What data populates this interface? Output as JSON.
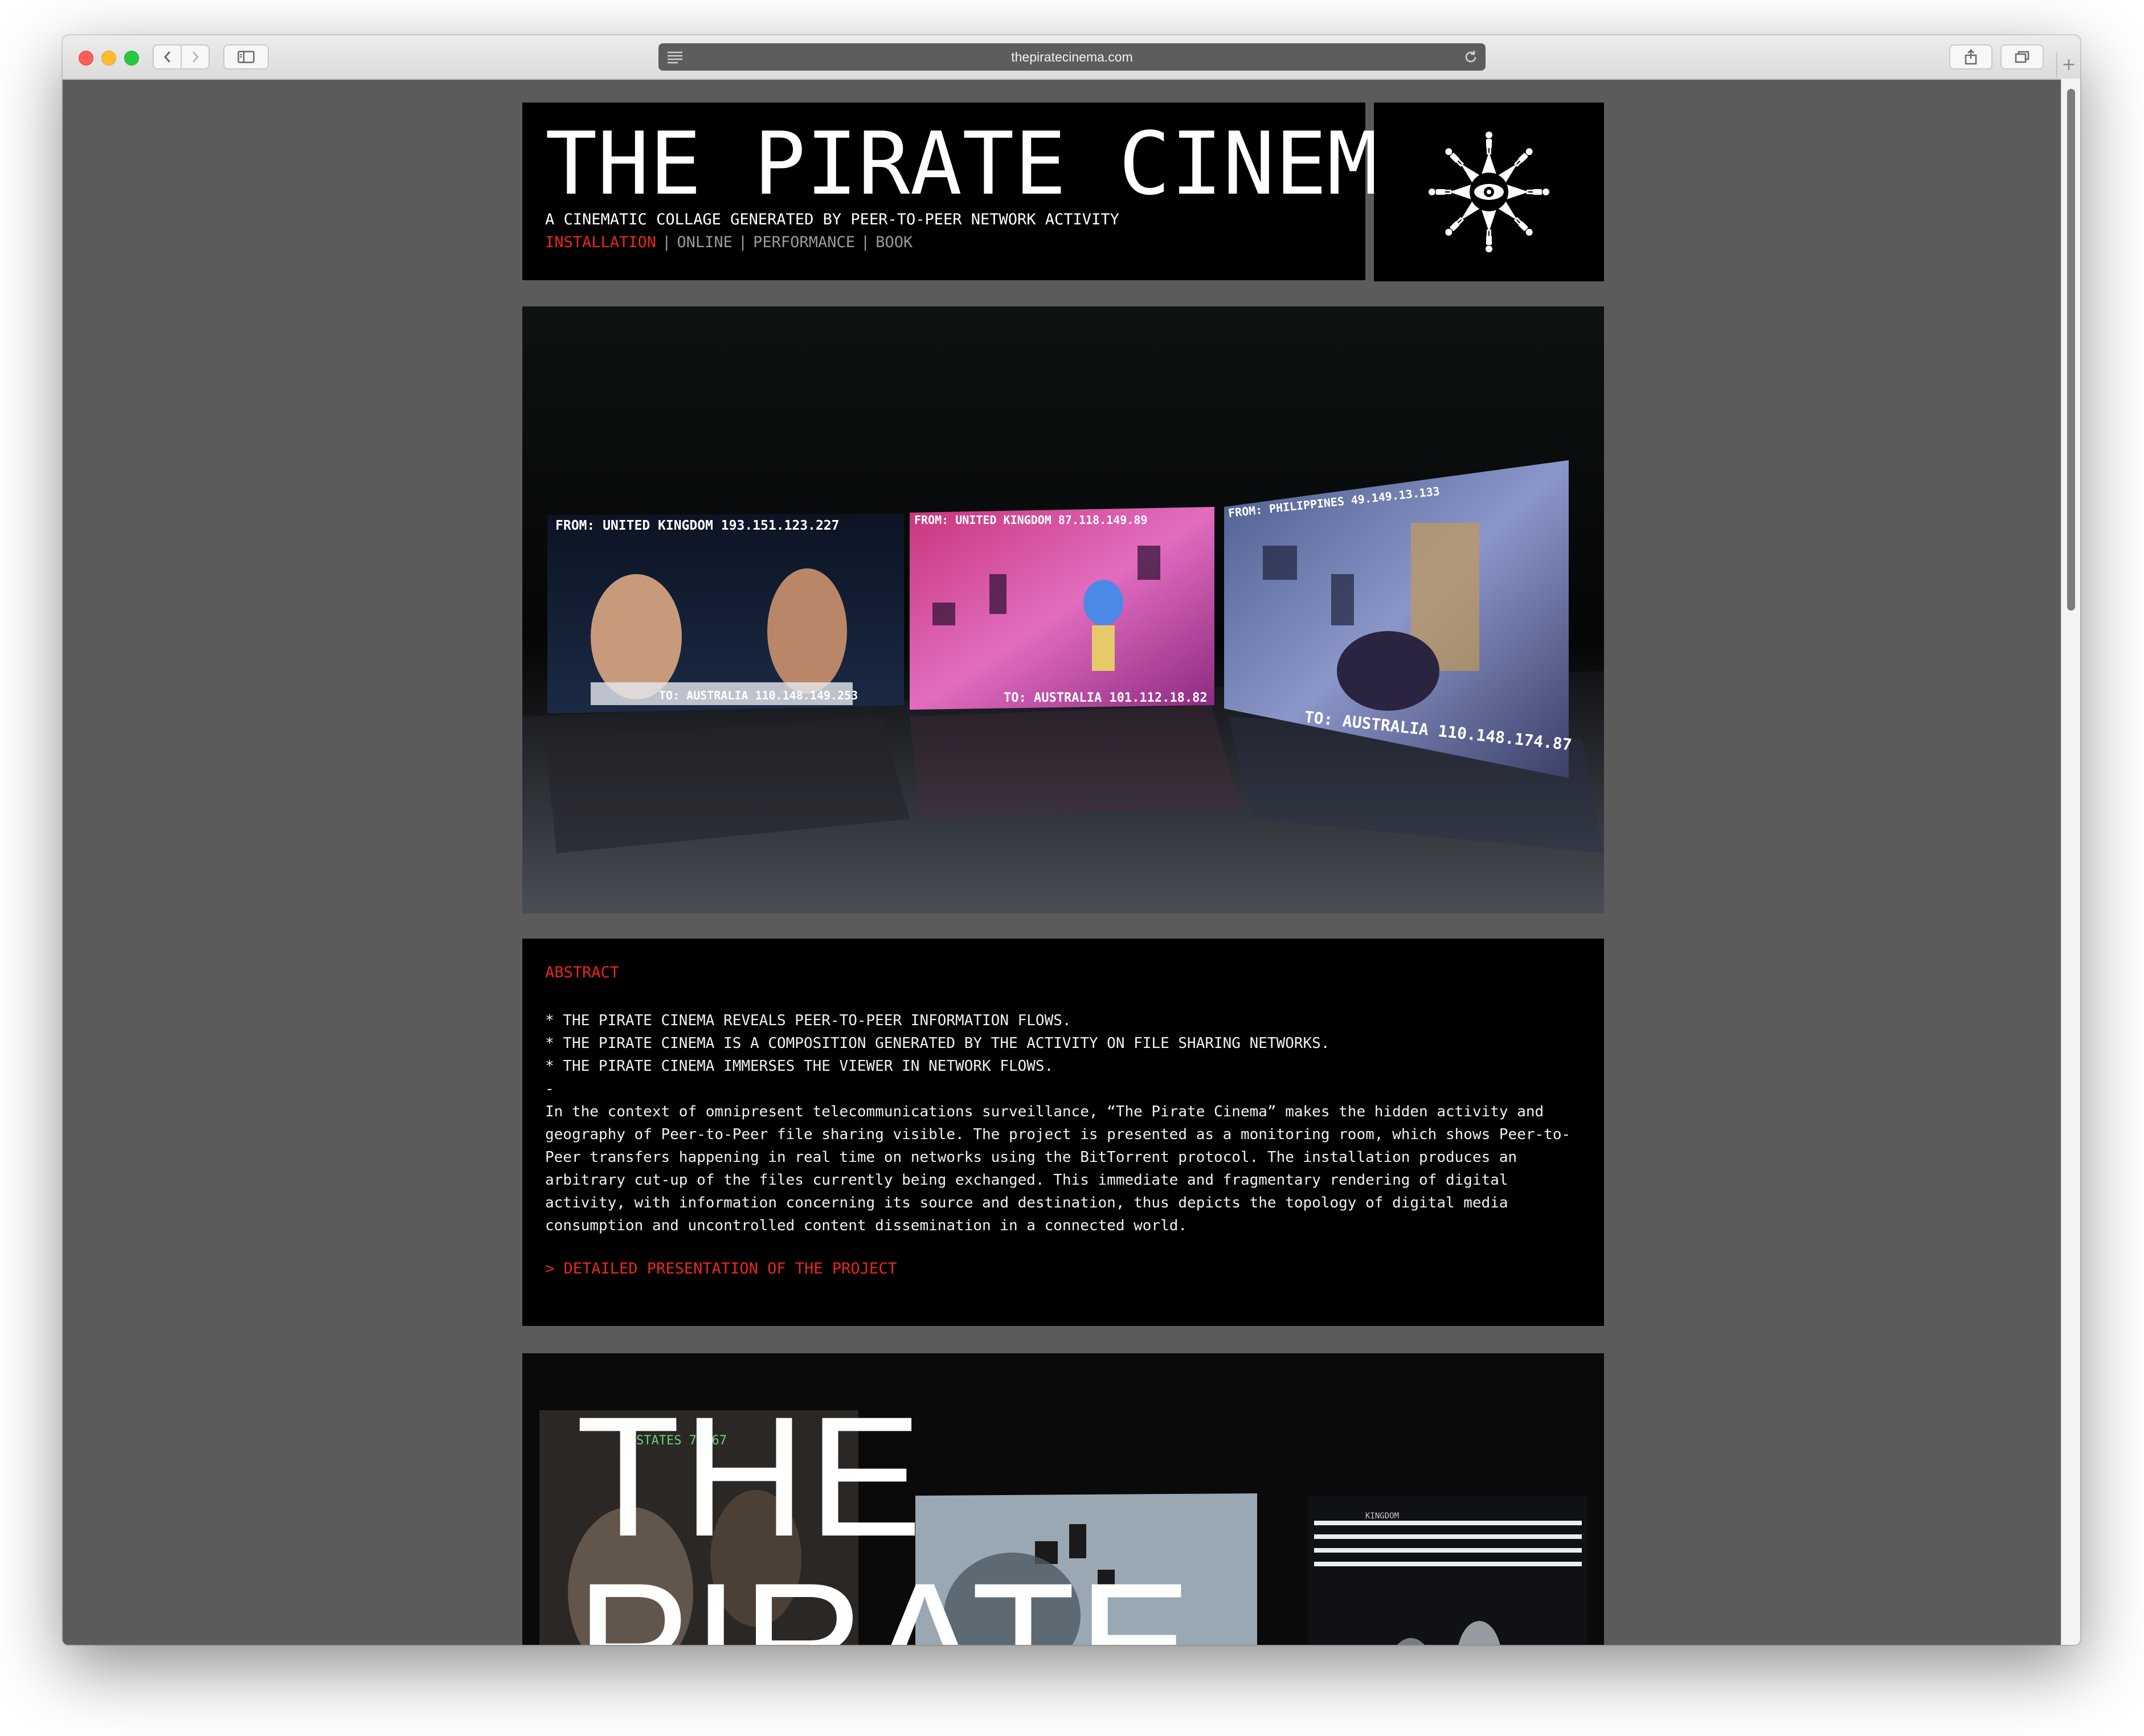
{
  "browser": {
    "url": "thepiratecinema.com",
    "new_tab_symbol": "+"
  },
  "header": {
    "title": "THE PIRATE CINEMA",
    "tagline": "A CINEMATIC COLLAGE GENERATED BY PEER-TO-PEER NETWORK ACTIVITY",
    "nav": [
      {
        "label": "INSTALLATION",
        "active": true
      },
      {
        "label": "ONLINE",
        "active": false
      },
      {
        "label": "PERFORMANCE",
        "active": false
      },
      {
        "label": "BOOK",
        "active": false
      }
    ],
    "nav_separator": "|"
  },
  "hero_image": {
    "screens": [
      {
        "from_label": "FROM: UNITED KINGDOM 193.151.123.227",
        "to_label": "TO: AUSTRALIA 110.148.149.253"
      },
      {
        "from_label": "FROM: UNITED KINGDOM 87.118.149.89",
        "to_label": "TO: AUSTRALIA 101.112.18.82"
      },
      {
        "from_label": "FROM: PHILIPPINES 49.149.13.133",
        "to_label": "TO: AUSTRALIA 110.148.174.87"
      }
    ]
  },
  "abstract": {
    "heading": "ABSTRACT",
    "bullets": [
      "* THE PIRATE CINEMA REVEALS PEER-TO-PEER INFORMATION FLOWS.",
      "* THE PIRATE CINEMA IS A COMPOSITION GENERATED BY THE ACTIVITY ON FILE SHARING NETWORKS.",
      "* THE PIRATE CINEMA IMMERSES THE VIEWER IN NETWORK FLOWS.",
      "-"
    ],
    "body": "In the context of omnipresent telecommunications surveillance, “The Pirate Cinema” makes the hidden activity and geography of Peer-to-Peer file sharing visible. The project is presented as a monitoring room, which shows Peer-to-Peer transfers happening in real time on networks using the BitTorrent protocol. The installation produces an arbitrary cut-up of the files currently being exchanged. This immediate and fragmentary rendering of digital activity, with information concerning its source and destination, thus depicts the topology of digital media consumption and uncontrolled content dissemination in a connected world.",
    "link": "> DETAILED PRESENTATION OF THE PROJECT"
  },
  "hero_image_2": {
    "title_lines": "THE\nPIRATE",
    "overlay_text": "STATES 75.67",
    "screen_label": "KINGDOM"
  },
  "colors": {
    "accent": "#e8281c",
    "page_bg": "#5b5b5b",
    "panel_bg": "#000000",
    "nav_inactive": "#9a9a9a"
  },
  "icons": [
    "reader-icon",
    "reload-icon",
    "share-icon",
    "tabs-icon",
    "sidebar-icon",
    "back-icon",
    "forward-icon",
    "pirate-cinema-logo-icon"
  ]
}
